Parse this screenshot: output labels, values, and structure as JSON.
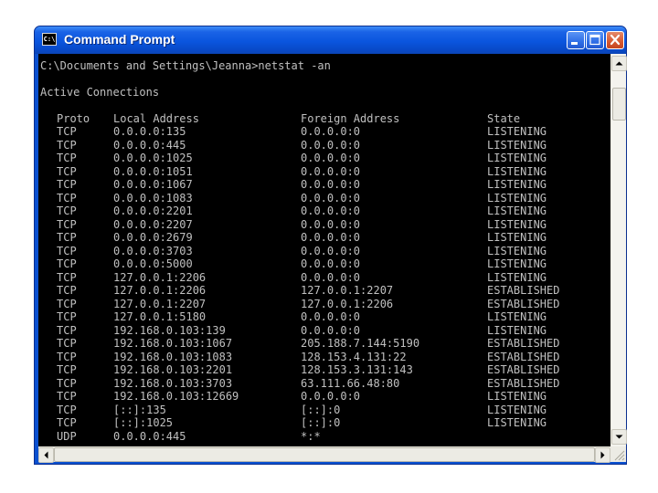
{
  "window": {
    "title": "Command Prompt",
    "icon_text": "C:\\",
    "buttons": {
      "minimize": "minimize-icon",
      "maximize": "maximize-icon",
      "close": "close-icon"
    }
  },
  "console": {
    "command_line": "C:\\Documents and Settings\\Jeanna>netstat -an",
    "section_title": "Active Connections",
    "headers": [
      "Proto",
      "Local Address",
      "Foreign Address",
      "State"
    ],
    "rows": [
      [
        "TCP",
        "0.0.0.0:135",
        "0.0.0.0:0",
        "LISTENING"
      ],
      [
        "TCP",
        "0.0.0.0:445",
        "0.0.0.0:0",
        "LISTENING"
      ],
      [
        "TCP",
        "0.0.0.0:1025",
        "0.0.0.0:0",
        "LISTENING"
      ],
      [
        "TCP",
        "0.0.0.0:1051",
        "0.0.0.0:0",
        "LISTENING"
      ],
      [
        "TCP",
        "0.0.0.0:1067",
        "0.0.0.0:0",
        "LISTENING"
      ],
      [
        "TCP",
        "0.0.0.0:1083",
        "0.0.0.0:0",
        "LISTENING"
      ],
      [
        "TCP",
        "0.0.0.0:2201",
        "0.0.0.0:0",
        "LISTENING"
      ],
      [
        "TCP",
        "0.0.0.0:2207",
        "0.0.0.0:0",
        "LISTENING"
      ],
      [
        "TCP",
        "0.0.0.0:2679",
        "0.0.0.0:0",
        "LISTENING"
      ],
      [
        "TCP",
        "0.0.0.0:3703",
        "0.0.0.0:0",
        "LISTENING"
      ],
      [
        "TCP",
        "0.0.0.0:5000",
        "0.0.0.0:0",
        "LISTENING"
      ],
      [
        "TCP",
        "127.0.0.1:2206",
        "0.0.0.0:0",
        "LISTENING"
      ],
      [
        "TCP",
        "127.0.0.1:2206",
        "127.0.0.1:2207",
        "ESTABLISHED"
      ],
      [
        "TCP",
        "127.0.0.1:2207",
        "127.0.0.1:2206",
        "ESTABLISHED"
      ],
      [
        "TCP",
        "127.0.0.1:5180",
        "0.0.0.0:0",
        "LISTENING"
      ],
      [
        "TCP",
        "192.168.0.103:139",
        "0.0.0.0:0",
        "LISTENING"
      ],
      [
        "TCP",
        "192.168.0.103:1067",
        "205.188.7.144:5190",
        "ESTABLISHED"
      ],
      [
        "TCP",
        "192.168.0.103:1083",
        "128.153.4.131:22",
        "ESTABLISHED"
      ],
      [
        "TCP",
        "192.168.0.103:2201",
        "128.153.3.131:143",
        "ESTABLISHED"
      ],
      [
        "TCP",
        "192.168.0.103:3703",
        "63.111.66.48:80",
        "ESTABLISHED"
      ],
      [
        "TCP",
        "192.168.0.103:12669",
        "0.0.0.0:0",
        "LISTENING"
      ],
      [
        "TCP",
        "[::]:135",
        "[::]:0",
        "LISTENING"
      ],
      [
        "TCP",
        "[::]:1025",
        "[::]:0",
        "LISTENING"
      ],
      [
        "UDP",
        "0.0.0.0:445",
        "*:*",
        ""
      ]
    ]
  },
  "colors": {
    "titlebar": "#0a55de",
    "console_background": "#000000",
    "console_text": "#c0c0c0"
  }
}
